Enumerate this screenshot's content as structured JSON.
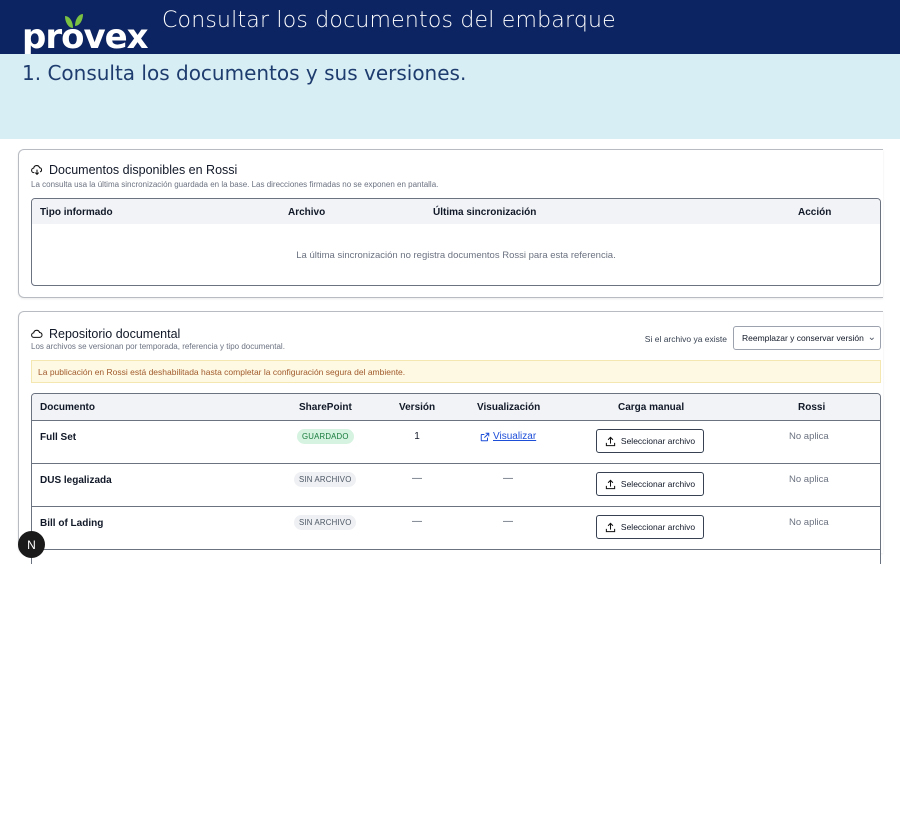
{
  "header": {
    "logo_text": "provex",
    "title": "Consultar los documentos del embarque",
    "colors": {
      "bar": "#0c2461",
      "leaf": "#7cc242",
      "band": "#d8eef5"
    }
  },
  "step": {
    "text": "1. Consulta los documentos y sus versiones."
  },
  "rossi_card": {
    "icon": "cloud-download-icon",
    "title": "Documentos disponibles en Rossi",
    "subtitle": "La consulta usa la última sincronización guardada en la base. Las direcciones firmadas no se exponen en pantalla.",
    "columns": [
      "Tipo informado",
      "Archivo",
      "Última sincronización",
      "Acción"
    ],
    "empty_message": "La última sincronización no registra documentos Rossi para esta referencia."
  },
  "repo_card": {
    "icon": "cloud-icon",
    "title": "Repositorio documental",
    "subtitle": "Los archivos se versionan por temporada, referencia y tipo documental.",
    "select_label": "Si el archivo ya existe",
    "select_value": "Reemplazar y conservar versión",
    "warning": "La publicación en Rossi está deshabilitada hasta completar la configuración segura del ambiente.",
    "columns": [
      "Documento",
      "SharePoint",
      "Versión",
      "Visualización",
      "Carga manual",
      "Rossi"
    ],
    "rows": [
      {
        "documento": "Full Set",
        "sharepoint": "GUARDADO",
        "status": "ok",
        "version": "1",
        "visualizacion": "Visualizar",
        "carga": "Seleccionar archivo",
        "rossi": "No aplica"
      },
      {
        "documento": "DUS legalizada",
        "sharepoint": "SIN ARCHIVO",
        "status": "none",
        "version": "—",
        "visualizacion": "—",
        "carga": "Seleccionar archivo",
        "rossi": "No aplica"
      },
      {
        "documento": "Bill of Lading",
        "sharepoint": "SIN ARCHIVO",
        "status": "none",
        "version": "—",
        "visualizacion": "—",
        "carga": "Seleccionar archivo",
        "rossi": "No aplica"
      }
    ]
  },
  "overlay": {
    "bubble_letter": "N"
  }
}
